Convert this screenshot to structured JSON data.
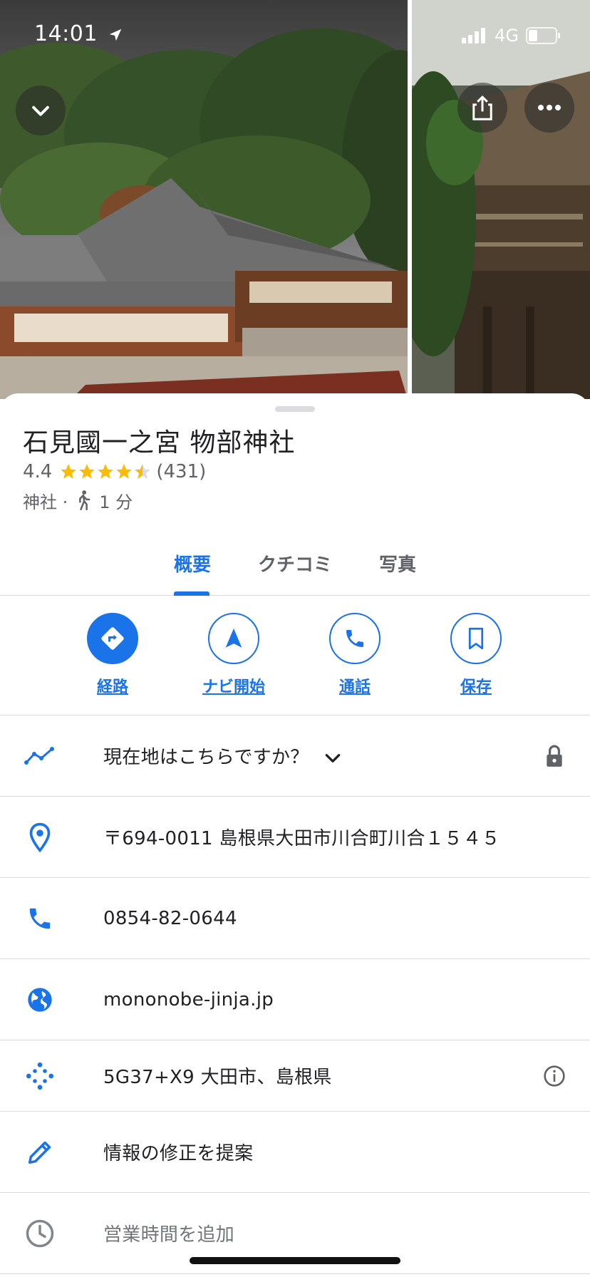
{
  "status_bar": {
    "time": "14:01",
    "network": "4G"
  },
  "header": {
    "photo_main": "shrine-photo",
    "photo_side": "shrine-photo-2"
  },
  "place": {
    "name": "石見國一之宮 物部神社",
    "rating": "4.4",
    "rating_value": 4.4,
    "review_count": "(431)",
    "category": "神社 ·",
    "walk_time": "1 分"
  },
  "tabs": [
    {
      "label": "概要",
      "active": true
    },
    {
      "label": "クチコミ",
      "active": false
    },
    {
      "label": "写真",
      "active": false
    }
  ],
  "actions": [
    {
      "label": "経路",
      "icon": "directions-icon"
    },
    {
      "label": "ナビ開始",
      "icon": "navigation-arrow-icon"
    },
    {
      "label": "通話",
      "icon": "phone-icon"
    },
    {
      "label": "保存",
      "icon": "bookmark-icon"
    }
  ],
  "info": {
    "location_prompt": "現在地はこちらですか？",
    "address": "〒694-0011 島根県大田市川合町川合１５４５",
    "phone": "0854-82-0644",
    "website": "mononobe-jinja.jp",
    "plus_code": "5G37+X9 大田市、島根県",
    "suggest_edit": "情報の修正を提案",
    "add_hours": "営業時間を追加"
  },
  "colors": {
    "accent": "#1a73e8",
    "star": "#fbbc04",
    "divider": "#dadce0",
    "muted_text": "#70757a"
  }
}
